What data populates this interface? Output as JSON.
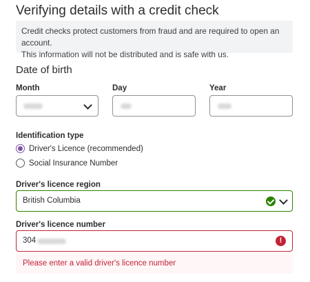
{
  "page": {
    "title": "Verifying details with a credit check"
  },
  "info": {
    "text_line1": "Credit checks protect customers from fraud and are required to open an account.",
    "text_line2": "This information will not be distributed and is safe with us."
  },
  "dob": {
    "section_title": "Date of birth",
    "month_label": "Month",
    "day_label": "Day",
    "year_label": "Year"
  },
  "identification": {
    "label": "Identification type",
    "options": [
      {
        "label": "Driver's Licence (recommended)",
        "checked": true
      },
      {
        "label": "Social Insurance Number",
        "checked": false
      }
    ]
  },
  "region": {
    "label": "Driver's licence region",
    "value": "British Columbia",
    "status": "valid"
  },
  "licence": {
    "label": "Driver's licence number",
    "value_visible": "304",
    "status": "error",
    "error_message": "Please enter a valid driver's licence number"
  },
  "colors": {
    "valid": "#2b8000",
    "error": "#c12335",
    "accent": "#7c53a5"
  },
  "icons": {
    "valid": "check-circle-icon",
    "error": "exclamation-circle-icon",
    "dropdown": "chevron-down-icon"
  }
}
